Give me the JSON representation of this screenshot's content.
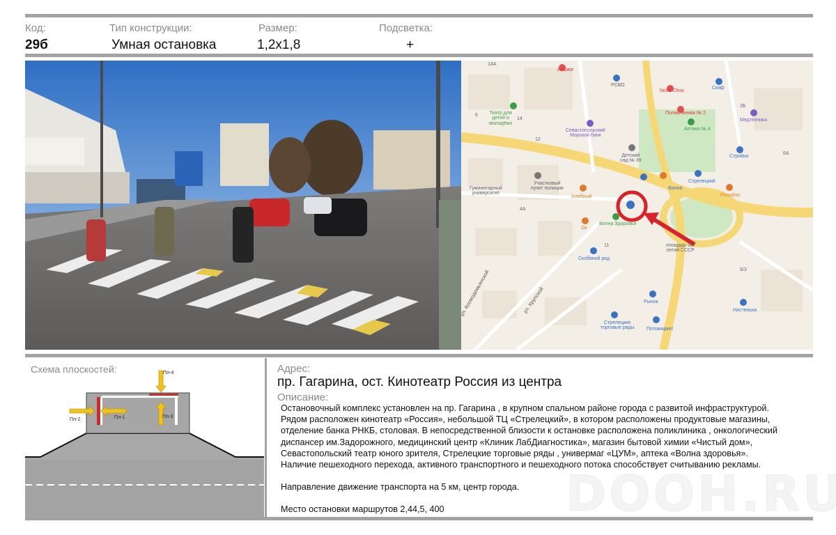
{
  "header": {
    "code_label": "Код:",
    "code_value": "29б",
    "type_label": "Тип конструкции:",
    "type_value": "Умная остановка",
    "size_label": "Размер:",
    "size_value": "1,2х1,8",
    "light_label": "Подсветка:",
    "light_value": "+"
  },
  "map": {
    "labels": {
      "almog": "Альмог",
      "rsvo": "РСВО",
      "nova": "Nova Clinic",
      "skif": "Скиф",
      "poly": "Поликлиника № 2",
      "apteka4": "Аптека № 4",
      "medtechnika": "Медтехника",
      "theatre": "Театр для\nдетей и\nмолодёжи",
      "bank": "Севастопольский\nМорской банк",
      "kindergarten": "Детский\nсад № 39",
      "stroyka": "Стройка",
      "volna": "Волна",
      "strelecky": "Стрелецкий",
      "piccolino": "Piccolino",
      "police": "Участковый\nпункт полиции",
      "univ": "Гуманитарный\nуниверситет",
      "hlebny": "Хлебный",
      "ok": "Ок",
      "volna_zd": "Волна Здоровья",
      "skobyany": "Скобяной ряд",
      "square": "площадь 50-\nлетия СССР",
      "krupskoy": "ул. Крупской",
      "kosmo": "ул. Космодемьянской",
      "rynok": "Рынок",
      "nastenka": "Настенька",
      "trade_rows": "Стрелецкие\nторговые ряды",
      "potomarket": "Потомаркет",
      "n14a": "14А",
      "n14": "14",
      "n12": "12",
      "n6": "6",
      "n2b": "2Б",
      "n6a": "6А",
      "n11": "11",
      "n4a": "4А",
      "n5_3": "5/3"
    }
  },
  "scheme": {
    "title": "Схема плоскостей:",
    "pl1": "Пл-1",
    "pl2": "Пл-2",
    "pl3": "Пл-3",
    "pl4": "Пл-4"
  },
  "address": {
    "label": "Адрес:",
    "value": "пр. Гагарина, ост. Кинотеатр Россия из центра"
  },
  "description": {
    "label": "Описание:",
    "lines": [
      "Остановочный комплекс установлен на пр. Гагарина , в крупном спальном районе города  с развитой инфраструктурой.",
      "Рядом расположен  кинотеатр «Россия», небольшой  ТЦ «Стрелецкий», в котором расположены продуктовые магазины,",
      "отделение банка РНКБ, столовая. В непосредственной близости к остановке расположена поликлиника , онкологический",
      "диспансер им.Задорожного, медицинский центр «Клиник ЛабДиагностика», магазин бытовой химии «Чистый дом»,",
      "Севастопольский театр юного зрителя,  Стрелецкие торговые ряды , универмаг «ЦУМ», аптека «Волна здоровья».",
      "Наличие пешеходного перехода, активного транспортного и пешеходного потока способствует    считыванию рекламы."
    ],
    "direction": "Направление движение транспорта на 5 км, центр города.",
    "routes": "Место остановки маршрутов 2,44,5, 400"
  },
  "watermark": "DOOH.RU",
  "colors": {
    "rule_gray": "#a3a3a3",
    "highlight_red": "#d8232a",
    "arrow_yellow": "#f3c21a",
    "plane_red": "#cc2b2b",
    "map_road_yellow": "#f6d776",
    "map_park_green": "#cfe8c4"
  }
}
